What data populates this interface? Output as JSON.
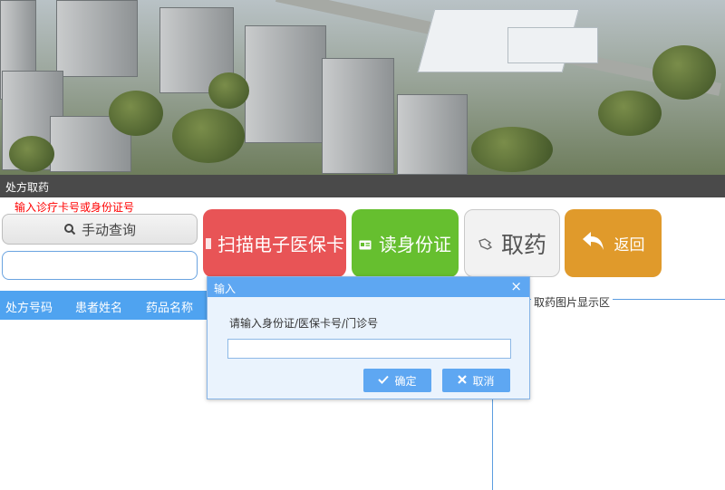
{
  "window": {
    "title": "处方取药"
  },
  "form": {
    "hint": "输入诊疗卡号或身份证号",
    "manual_query_label": "手动查询",
    "card_input_value": ""
  },
  "actions": {
    "scan_label": "扫描电子医保卡",
    "read_id_label": "读身份证",
    "take_medicine_label": "取药",
    "back_label": "返回"
  },
  "table": {
    "headers": [
      "处方号码",
      "患者姓名",
      "药品名称"
    ]
  },
  "image_panel": {
    "legend": "取药图片显示区"
  },
  "dialog": {
    "title": "输入",
    "prompt": "请输入身份证/医保卡号/门诊号",
    "input_value": "",
    "ok_label": "确定",
    "cancel_label": "取消"
  },
  "colors": {
    "scan": "#e85456",
    "read_id": "#66bf2f",
    "take": "#f2f2f2",
    "back": "#e09a2b",
    "accent": "#5ea7f2",
    "hint": "#ff0000"
  },
  "icons": {
    "manual_query": "search-icon",
    "scan": "card-icon",
    "read_id": "id-card-icon",
    "take": "hand-icon",
    "back": "undo-arrow-icon",
    "ok": "check-icon",
    "cancel": "x-icon",
    "dialog_close": "close-icon"
  }
}
